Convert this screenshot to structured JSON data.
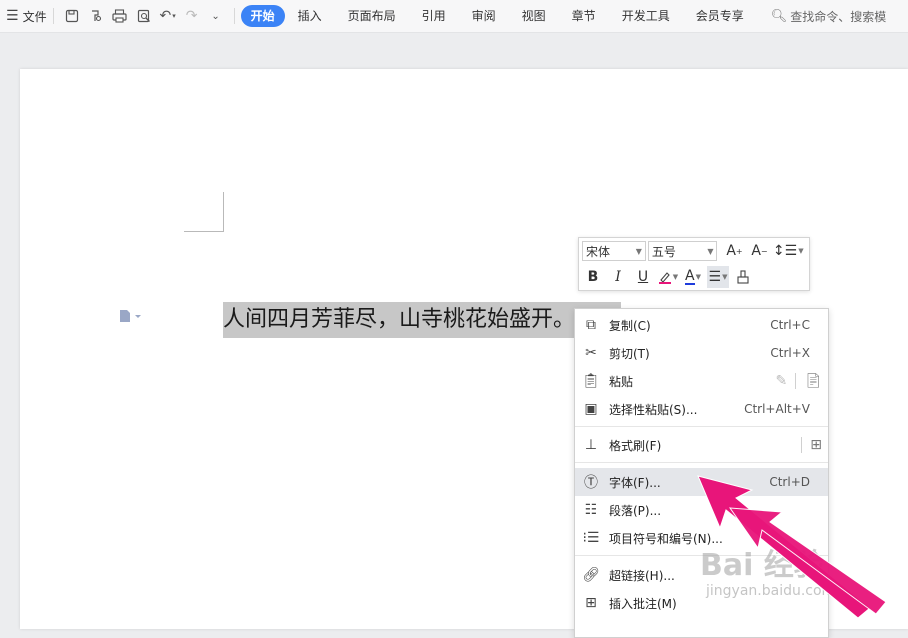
{
  "menubar": {
    "file_label": "文件",
    "tabs": [
      {
        "label": "开始",
        "active": true
      },
      {
        "label": "插入",
        "active": false
      },
      {
        "label": "页面布局",
        "active": false
      },
      {
        "label": "引用",
        "active": false
      },
      {
        "label": "审阅",
        "active": false
      },
      {
        "label": "视图",
        "active": false
      },
      {
        "label": "章节",
        "active": false
      },
      {
        "label": "开发工具",
        "active": false
      },
      {
        "label": "会员专享",
        "active": false
      }
    ],
    "search_text": "查找命令、搜索模"
  },
  "document": {
    "text": "人间四月芳菲尽，山寺桃花始盛开。"
  },
  "mini_toolbar": {
    "font_name": "宋体",
    "font_size": "五号"
  },
  "context_menu": {
    "items": [
      {
        "label": "复制(C)",
        "shortcut": "Ctrl+C",
        "icon": "copy-icon"
      },
      {
        "label": "剪切(T)",
        "shortcut": "Ctrl+X",
        "icon": "scissors-icon"
      },
      {
        "label": "粘贴",
        "shortcut": "",
        "icon": "paste-icon"
      },
      {
        "label": "选择性粘贴(S)...",
        "shortcut": "Ctrl+Alt+V",
        "icon": "paste-special-icon"
      },
      {
        "label": "格式刷(F)",
        "shortcut": "",
        "icon": "format-painter-icon"
      },
      {
        "label": "字体(F)...",
        "shortcut": "Ctrl+D",
        "icon": "font-icon"
      },
      {
        "label": "段落(P)...",
        "shortcut": "",
        "icon": "paragraph-icon"
      },
      {
        "label": "项目符号和编号(N)...",
        "shortcut": "",
        "icon": "bullet-list-icon"
      },
      {
        "label": "超链接(H)...",
        "shortcut": "",
        "icon": "link-icon"
      },
      {
        "label": "插入批注(M)",
        "shortcut": "",
        "icon": "comment-icon"
      }
    ]
  },
  "watermark": {
    "main": "Bai 经验",
    "sub": "jingyan.baidu.com"
  },
  "colors": {
    "accent": "#3b83f6",
    "arrow": "#e8157a"
  }
}
